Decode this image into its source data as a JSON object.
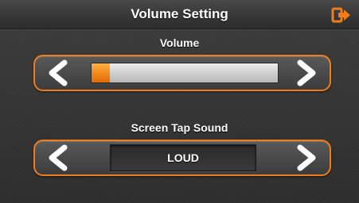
{
  "header": {
    "title": "Volume Setting",
    "exit_icon": "exit-icon"
  },
  "volume": {
    "label": "Volume",
    "level_fraction": 0.1,
    "left_icon": "chevron-left-icon",
    "right_icon": "chevron-right-icon"
  },
  "tap_sound": {
    "label": "Screen Tap Sound",
    "value": "LOUD",
    "left_icon": "chevron-left-icon",
    "right_icon": "chevron-right-icon"
  },
  "colors": {
    "accent": "#f07c1c",
    "background": "#353535",
    "text": "#ffffff"
  }
}
